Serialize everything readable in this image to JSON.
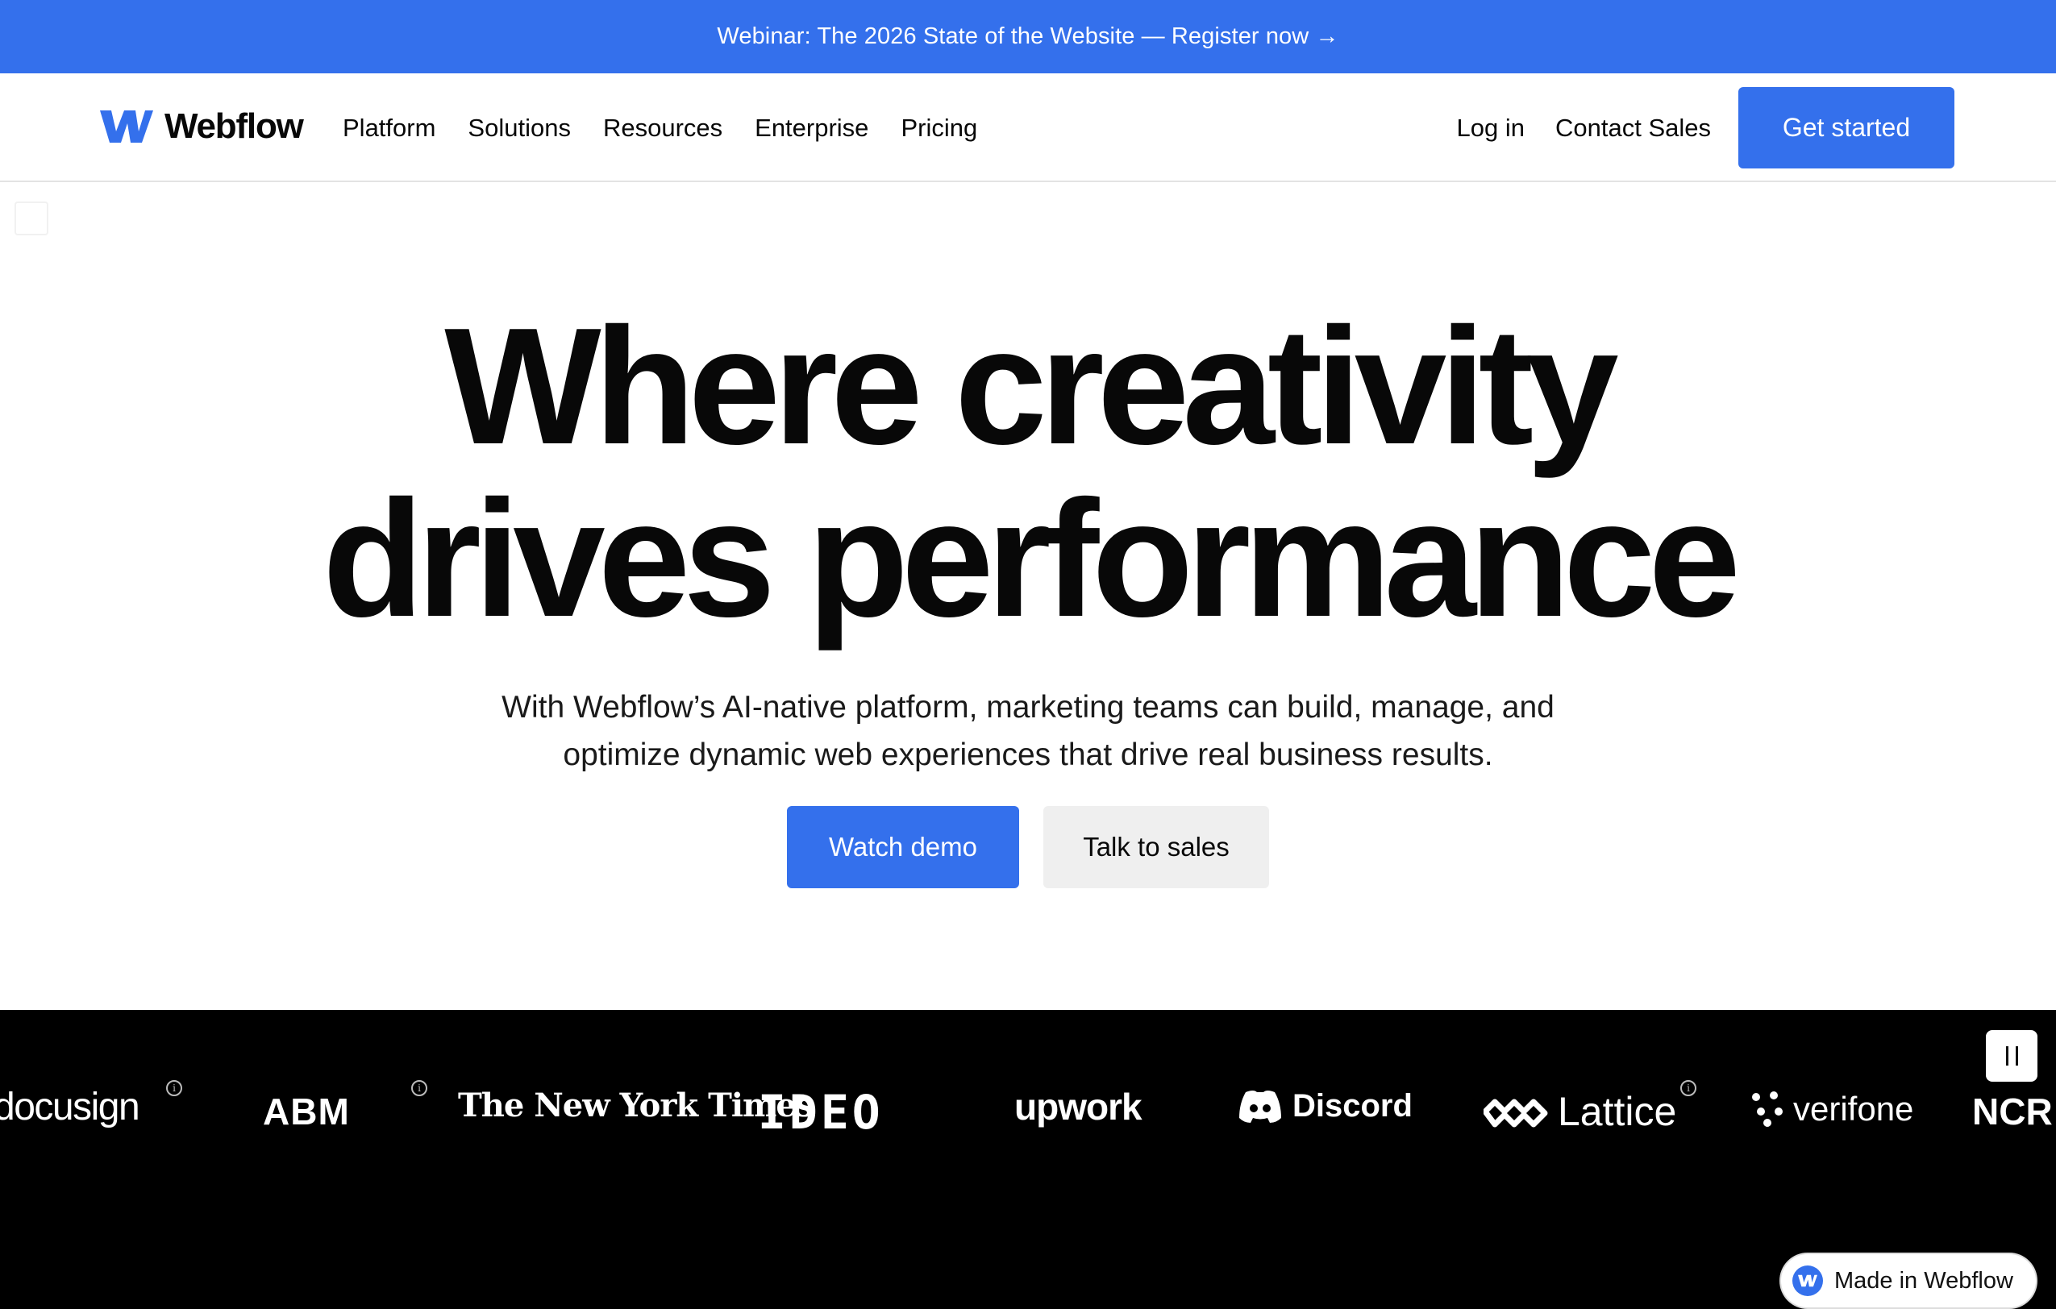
{
  "banner": {
    "text": "Webinar: The 2026 State of the Website — Register now →"
  },
  "nav": {
    "logo_text": "Webflow",
    "links": [
      "Platform",
      "Solutions",
      "Resources",
      "Enterprise",
      "Pricing"
    ],
    "login": "Log in",
    "contact": "Contact Sales",
    "cta": "Get started"
  },
  "hero": {
    "title_line1": "Where creativity",
    "title_line2": "drives performance",
    "subtitle_line1": "With Webflow’s AI-native platform, marketing teams can build, manage, and",
    "subtitle_line2": "optimize dynamic web experiences that drive real business results.",
    "primary_button": "Watch demo",
    "secondary_button": "Talk to sales"
  },
  "customers": {
    "logos": [
      "docusign",
      "ABM",
      "The New York Times",
      "IDEO",
      "upwork",
      "Discord",
      "Lattice",
      "verifone",
      "NCR"
    ]
  },
  "badge": {
    "label": "Made in Webflow"
  },
  "colors": {
    "accent": "#3470ec",
    "text": "#080808",
    "strip_bg": "#000000"
  }
}
